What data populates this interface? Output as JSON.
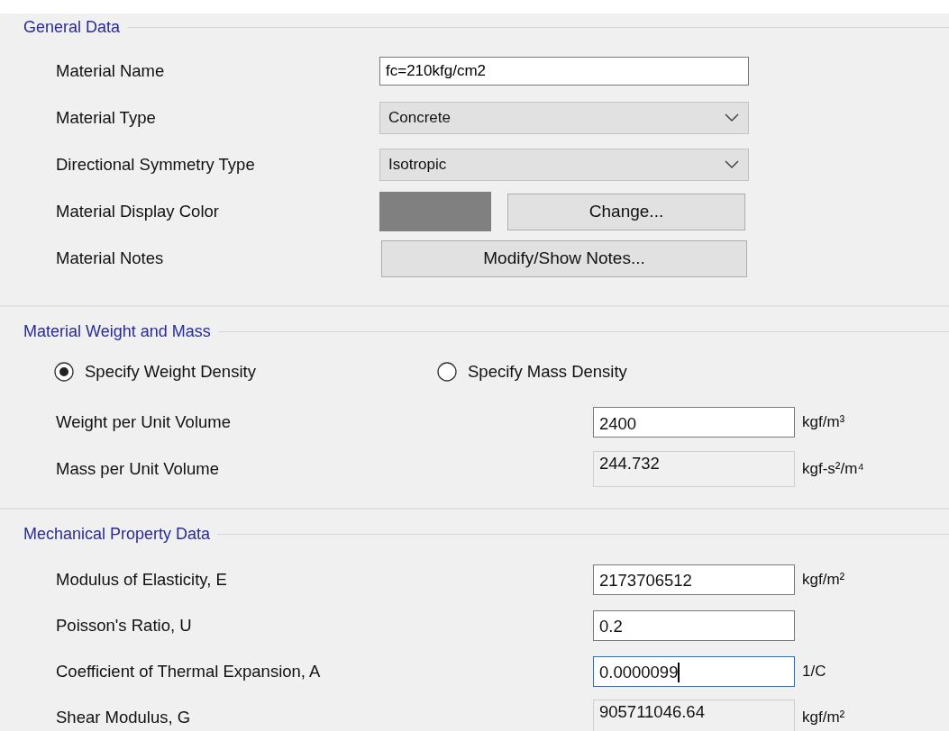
{
  "general": {
    "legend": "General Data",
    "rows": [
      {
        "kind": "text",
        "label": "Material Name",
        "value": "fc=210kfg/cm2"
      },
      {
        "kind": "select",
        "label": "Material Type",
        "value": "Concrete"
      },
      {
        "kind": "select",
        "label": "Directional Symmetry Type",
        "value": "Isotropic"
      },
      {
        "kind": "color",
        "label": "Material Display Color",
        "color": "#808080",
        "button": "Change..."
      },
      {
        "kind": "button",
        "label": "Material Notes",
        "button": "Modify/Show Notes..."
      }
    ]
  },
  "weight": {
    "legend": "Material Weight and Mass",
    "options": [
      {
        "label": "Specify Weight Density",
        "selected": true
      },
      {
        "label": "Specify Mass Density",
        "selected": false
      }
    ],
    "rows": [
      {
        "label": "Weight per Unit Volume",
        "value": "2400",
        "unit": "kgf/m³",
        "readonly": false,
        "focused": false
      },
      {
        "label": "Mass per Unit Volume",
        "value": "244.732",
        "unit": "kgf-s²/m⁴",
        "readonly": true,
        "focused": false
      }
    ]
  },
  "mechanical": {
    "legend": "Mechanical Property Data",
    "rows": [
      {
        "label": "Modulus of Elasticity,  E",
        "value": "2173706512",
        "unit": "kgf/m²",
        "readonly": false,
        "focused": false
      },
      {
        "label": "Poisson's Ratio,  U",
        "value": "0.2",
        "readonly": false,
        "focused": false
      },
      {
        "label": "Coefficient of Thermal Expansion,  A",
        "value": "0.0000099",
        "unit": "1/C",
        "readonly": false,
        "focused": true
      },
      {
        "label": "Shear Modulus,  G",
        "value": "905711046.64",
        "unit": "kgf/m²",
        "readonly": true,
        "focused": false
      }
    ]
  }
}
